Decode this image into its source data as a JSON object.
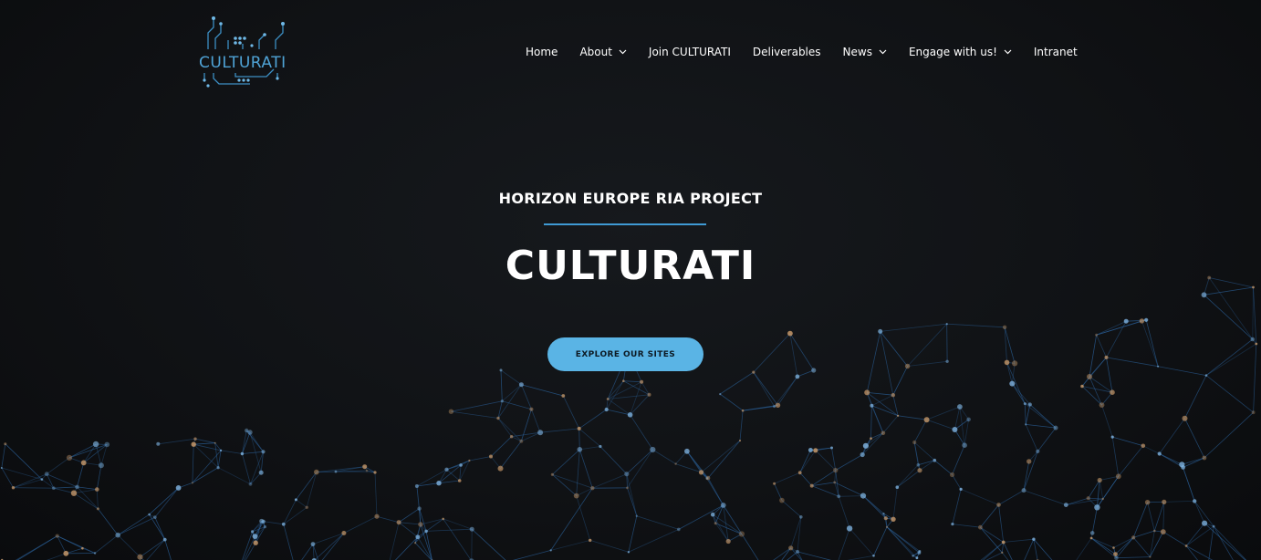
{
  "colors": {
    "background": "#101215",
    "accent": "#5ab4e5",
    "accent_line": "#3f9ad4",
    "logo_blue": "#4fa3d6",
    "network_line": "#2a5f97",
    "network_node_warm": "#c99a6a",
    "network_node_cool": "#7fb3e0"
  },
  "logo": {
    "text": "CULTURATI",
    "icon": "circuit-board-logo-icon"
  },
  "nav": {
    "items": [
      {
        "label": "Home",
        "dropdown": false
      },
      {
        "label": "About",
        "dropdown": true
      },
      {
        "label": "Join CULTURATI",
        "dropdown": false
      },
      {
        "label": "Deliverables",
        "dropdown": false
      },
      {
        "label": "News",
        "dropdown": true
      },
      {
        "label": "Engage with us!",
        "dropdown": true
      },
      {
        "label": "Intranet",
        "dropdown": false
      }
    ]
  },
  "hero": {
    "subtitle": "HORIZON EUROPE RIA PROJECT",
    "title": "CULTURATI",
    "cta_label": "EXPLORE OUR SITES"
  }
}
